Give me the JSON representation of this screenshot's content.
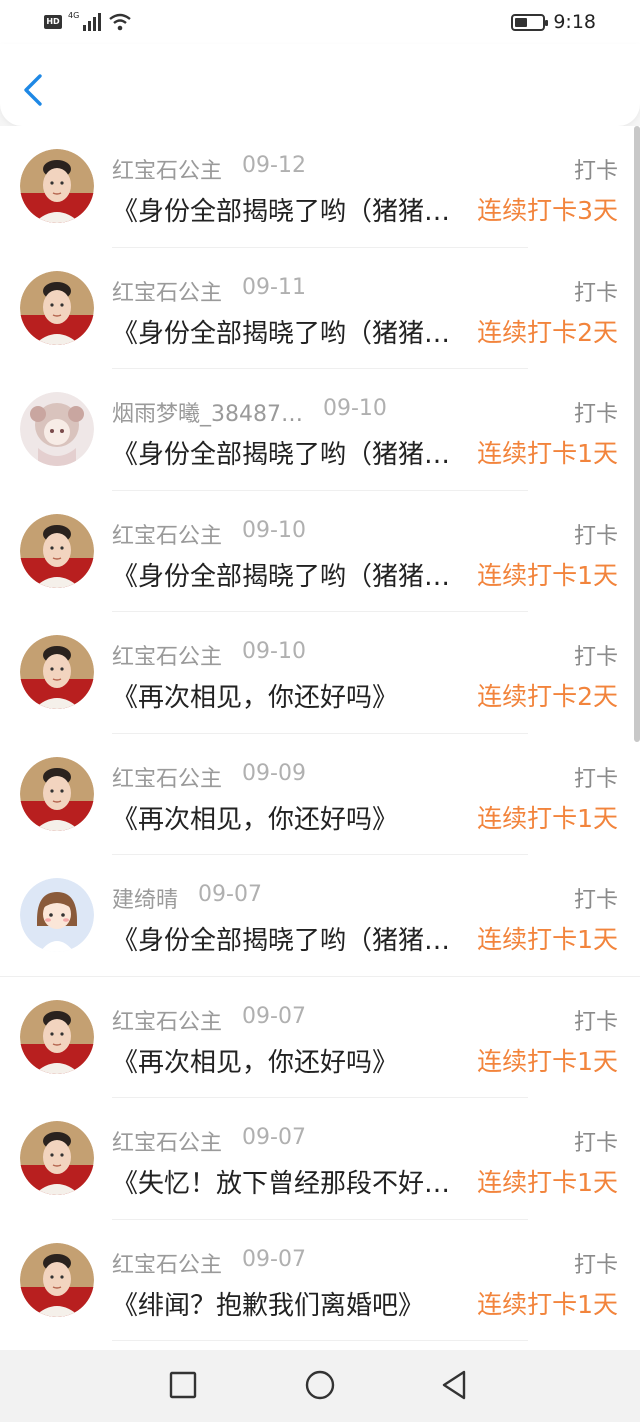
{
  "status_bar": {
    "hd": "HD",
    "network": "4G",
    "time": "9:18",
    "battery_level": 0.4
  },
  "nav": {
    "back_icon": "chevron-left-icon",
    "accent": "#1e88e5"
  },
  "theme": {
    "streak_color": "#f2843c"
  },
  "items": [
    {
      "user": "红宝石公主",
      "time": "09-12",
      "type": "打卡",
      "title": "《身份全部揭晓了哟（猪猪侠不是坏人）》",
      "streak": "连续打卡3天",
      "avatar": "avatar-princess"
    },
    {
      "user": "红宝石公主",
      "time": "09-11",
      "type": "打卡",
      "title": "《身份全部揭晓了哟（猪猪侠不是坏人）》",
      "streak": "连续打卡2天",
      "avatar": "avatar-princess"
    },
    {
      "user": "烟雨梦曦_38487…",
      "time": "09-10",
      "type": "打卡",
      "title": "《身份全部揭晓了哟（猪猪侠不是坏人）》",
      "streak": "连续打卡1天",
      "avatar": "avatar-doll"
    },
    {
      "user": "红宝石公主",
      "time": "09-10",
      "type": "打卡",
      "title": "《身份全部揭晓了哟（猪猪侠不是坏人）》",
      "streak": "连续打卡1天",
      "avatar": "avatar-princess"
    },
    {
      "user": "红宝石公主",
      "time": "09-10",
      "type": "打卡",
      "title": "《再次相见，你还好吗》",
      "streak": "连续打卡2天",
      "avatar": "avatar-princess"
    },
    {
      "user": "红宝石公主",
      "time": "09-09",
      "type": "打卡",
      "title": "《再次相见，你还好吗》",
      "streak": "连续打卡1天",
      "avatar": "avatar-princess"
    },
    {
      "user": "建绮晴",
      "time": "09-07",
      "type": "打卡",
      "title": "《身份全部揭晓了哟（猪猪侠不是坏人）》",
      "streak": "连续打卡1天",
      "avatar": "avatar-cartoon-girl"
    },
    {
      "user": "红宝石公主",
      "time": "09-07",
      "type": "打卡",
      "title": "《再次相见，你还好吗》",
      "streak": "连续打卡1天",
      "avatar": "avatar-princess"
    },
    {
      "user": "红宝石公主",
      "time": "09-07",
      "type": "打卡",
      "title": "《失忆！放下曾经那段不好的回忆》",
      "streak": "连续打卡1天",
      "avatar": "avatar-princess"
    },
    {
      "user": "红宝石公主",
      "time": "09-07",
      "type": "打卡",
      "title": "《绯闻？抱歉我们离婚吧》",
      "streak": "连续打卡1天",
      "avatar": "avatar-princess"
    }
  ],
  "system_nav": {
    "recents": "square-icon",
    "home": "circle-icon",
    "back": "triangle-back-icon"
  }
}
